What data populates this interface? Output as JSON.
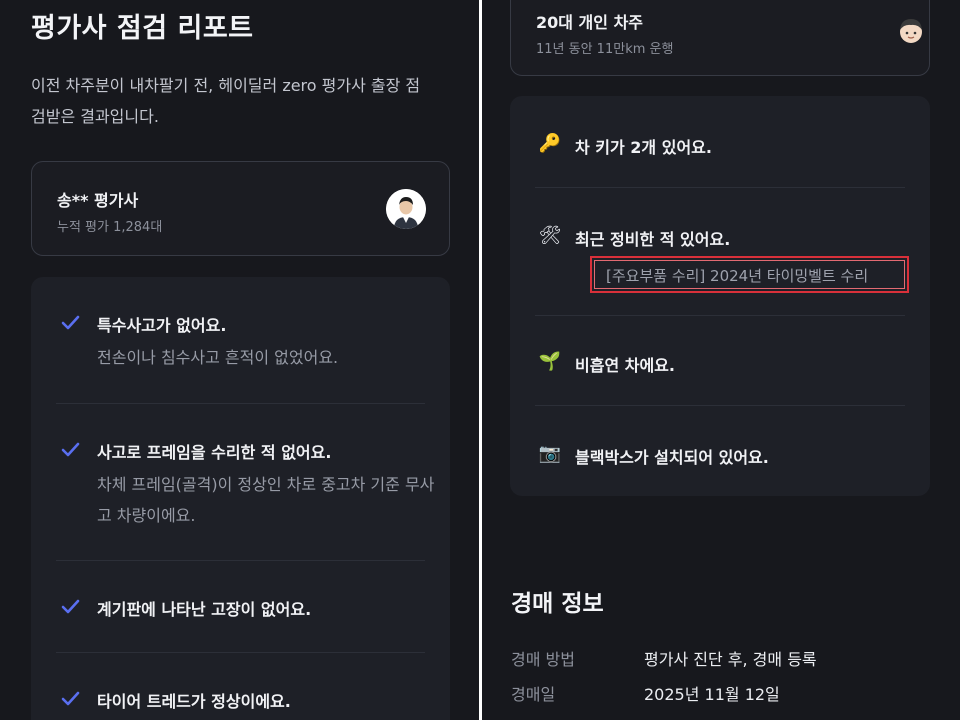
{
  "left": {
    "title": "평가사 점검 리포트",
    "intro": "이전 차주분이 내차팔기 전, 헤이딜러 zero 평가사 출장 점검받은 결과입니다.",
    "inspector": {
      "name": "송** 평가사",
      "stat": "누적 평가 1,284대"
    },
    "checks": [
      {
        "title": "특수사고가 없어요.",
        "desc": "전손이나 침수사고 흔적이 없었어요."
      },
      {
        "title": "사고로 프레임을 수리한 적 없어요.",
        "desc": "차체 프레임(골격)이 정상인 차로 중고차 기준 무사고 차량이에요."
      },
      {
        "title": "계기판에 나타난 고장이 없어요.",
        "desc": ""
      },
      {
        "title": "타이어 트레드가 정상이에요.",
        "desc": ""
      }
    ]
  },
  "right": {
    "owner": {
      "title": "20대 개인 차주",
      "sub": "11년 동안 11만km 운행"
    },
    "features": [
      {
        "icon": "key-icon",
        "glyph": "🔑",
        "title": "차 키가 2개 있어요."
      },
      {
        "icon": "tools-icon",
        "glyph": "🛠",
        "title": "최근 정비한 적 있어요.",
        "detail": "[주요부품 수리] 2024년 타이밍벨트 수리"
      },
      {
        "icon": "seedling-icon",
        "glyph": "🌱",
        "title": "비흡연 차에요."
      },
      {
        "icon": "camera-icon",
        "glyph": "📷",
        "title": "블랙박스가 설치되어 있어요."
      }
    ],
    "auction": {
      "title": "경매 정보",
      "rows": [
        {
          "label": "경매 방법",
          "value": "평가사 진단 후, 경매 등록"
        },
        {
          "label": "경매일",
          "value": "2025년 11월 12일"
        }
      ]
    }
  },
  "colors": {
    "background": "#17181d",
    "check": "#5a6ff0",
    "highlight_border": "#d9303a"
  }
}
